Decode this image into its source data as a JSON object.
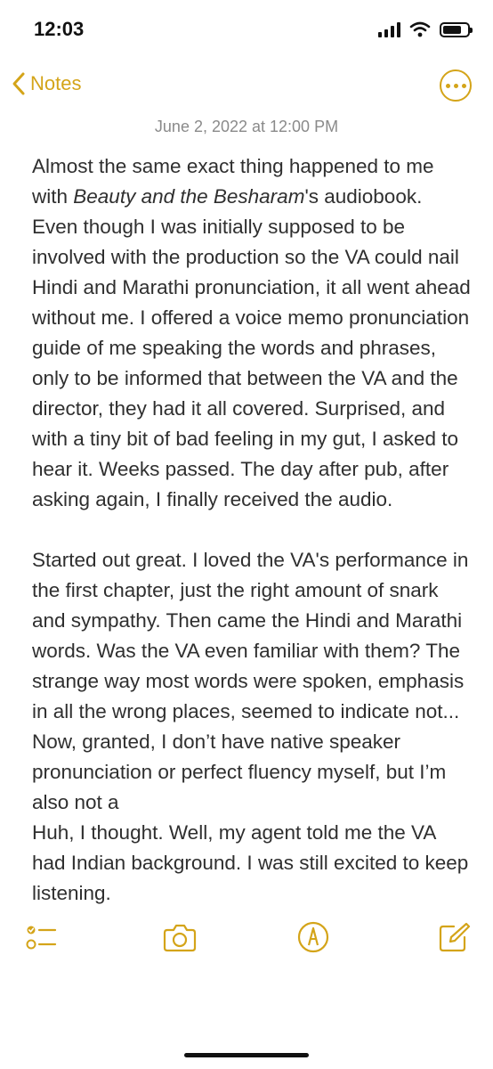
{
  "status_bar": {
    "time": "12:03",
    "battery_level": 0.75
  },
  "navbar": {
    "back_label": "Notes",
    "more_icon": "ellipsis-circle-icon",
    "accent_color": "#d4a419"
  },
  "note": {
    "date": "June 2, 2022 at 12:00 PM",
    "paragraph1_a": "Almost the same exact thing happened to me with ",
    "paragraph1_title": "Beauty and the Besharam",
    "paragraph1_b": "'s audiobook. Even though I was initially supposed to be involved with the production so the VA could nail Hindi and Marathi pronunciation, it all went ahead without me. I offered a voice memo pronunciation guide of me speaking the words and phrases, only to be informed that between the VA and the director, they had it all covered. Surprised, and with a tiny bit of bad feeling in my gut, I asked to hear it. Weeks passed. The day after pub, after asking again, I finally received the audio.",
    "paragraph2": "Started out great. I loved the VA's performance in the first chapter, just the right amount of snark and sympathy. Then came the Hindi and Marathi words. Was the VA even familiar with them? The strange way most words were spoken, emphasis in all the wrong places, seemed to indicate not... Now, granted, I don’t have native speaker pronunciation or perfect fluency myself, but I’m also not a",
    "paragraph3": "Huh, I thought. Well, my agent told me the VA had Indian background. I was still excited to keep listening."
  },
  "toolbar": {
    "checklist_icon": "checklist-icon",
    "camera_icon": "camera-icon",
    "markup_icon": "markup-pen-icon",
    "compose_icon": "compose-icon"
  }
}
